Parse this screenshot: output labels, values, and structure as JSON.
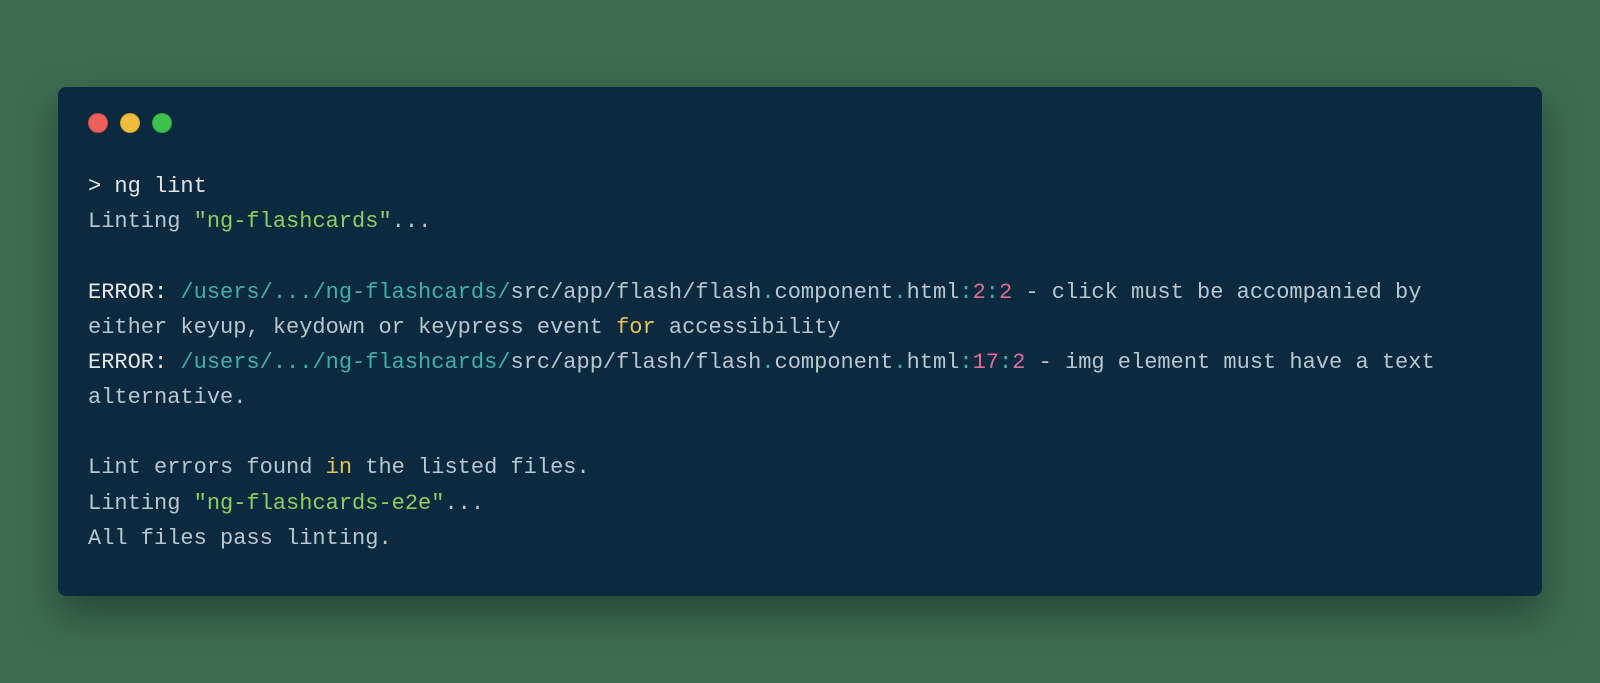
{
  "terminal": {
    "prompt": ">",
    "command": "ng lint",
    "lint1_prefix": "Linting ",
    "lint1_name": "\"ng-flashcards\"",
    "lint1_suffix": "...",
    "err_label": "ERROR: ",
    "err1_path_prefix": "/users/.../ng-flashcards/",
    "err1_path_mid": "src/app/flash/flash",
    "err1_path_dot1": ".",
    "err1_path_comp": "component",
    "err1_path_dot2": ".",
    "err1_path_ext": "html",
    "err1_loc_colon1": ":",
    "err1_loc_line": "2",
    "err1_loc_colon2": ":",
    "err1_loc_col": "2",
    "err1_msg_a": " - click must be accompanied by either keyup, keydown or keypress event ",
    "err1_msg_for": "for",
    "err1_msg_b": " accessibility",
    "err2_path_prefix": "/users/.../ng-flashcards/",
    "err2_path_mid": "src/app/flash/flash",
    "err2_path_dot1": ".",
    "err2_path_comp": "component",
    "err2_path_dot2": ".",
    "err2_path_ext": "html",
    "err2_loc_colon1": ":",
    "err2_loc_line": "17",
    "err2_loc_colon2": ":",
    "err2_loc_col": "2",
    "err2_msg": " - img element must have a text alternative.",
    "summary_a": "Lint errors found ",
    "summary_in": "in",
    "summary_b": " the listed files.",
    "lint2_prefix": "Linting ",
    "lint2_name": "\"ng-flashcards-e2e\"",
    "lint2_suffix": "...",
    "pass": "All files pass linting."
  },
  "colors": {
    "background_outer": "#3d6b52",
    "background_terminal": "#0b2a3f",
    "red": "#ec5f5a",
    "yellow": "#f2bd3d",
    "green_dot": "#3cc24a",
    "text_default": "#c9d9e2",
    "text_white": "#e6e6e6",
    "text_green": "#8ccf5e",
    "text_teal": "#3fb0a6",
    "text_yellow": "#e7c35a",
    "text_pink": "#e06c95"
  }
}
